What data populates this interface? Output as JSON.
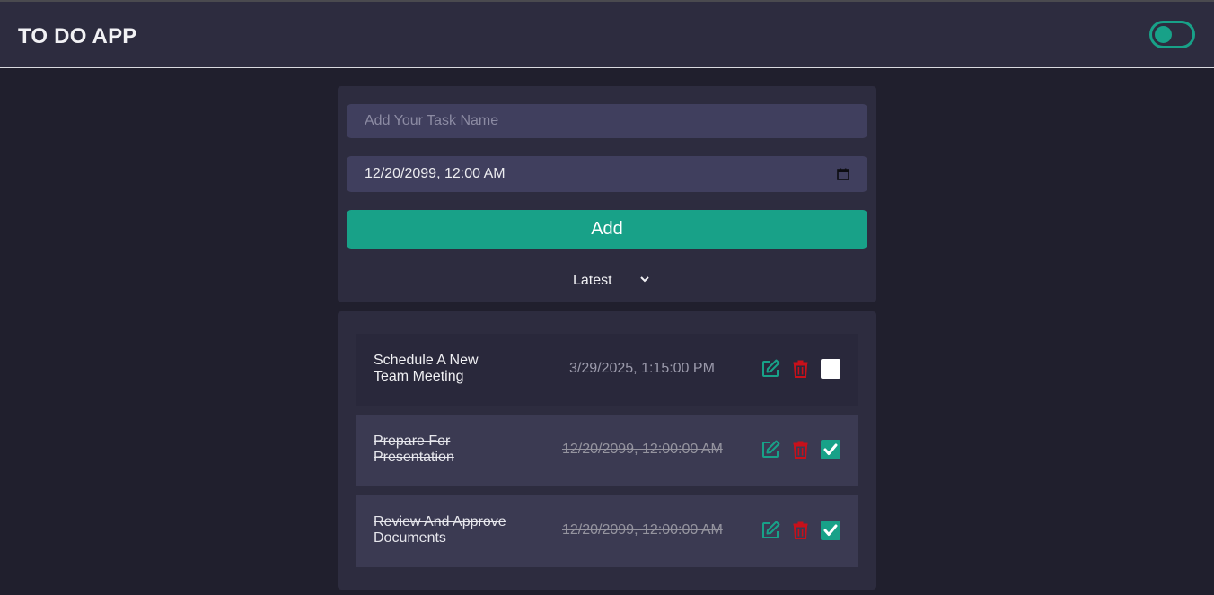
{
  "app": {
    "title": "TO DO APP"
  },
  "theme_toggle": {
    "state": "on",
    "accent": "#18a188"
  },
  "form": {
    "task_placeholder": "Add Your Task Name",
    "task_value": "",
    "date_value": "12/20/2099, 12:00 AM",
    "add_label": "Add",
    "sort_value": "Latest"
  },
  "tasks": [
    {
      "name": "Schedule A New Team Meeting",
      "date": "3/29/2025, 1:15:00 PM",
      "completed": false
    },
    {
      "name": "Prepare For Presentation",
      "date": "12/20/2099, 12:00:00 AM",
      "completed": true
    },
    {
      "name": "Review And Approve Documents",
      "date": "12/20/2099, 12:00:00 AM",
      "completed": true
    }
  ],
  "colors": {
    "background": "#201f2d",
    "panel": "#2d2c3f",
    "input": "#403f5e",
    "accent": "#18a188",
    "danger": "#c8101a"
  }
}
